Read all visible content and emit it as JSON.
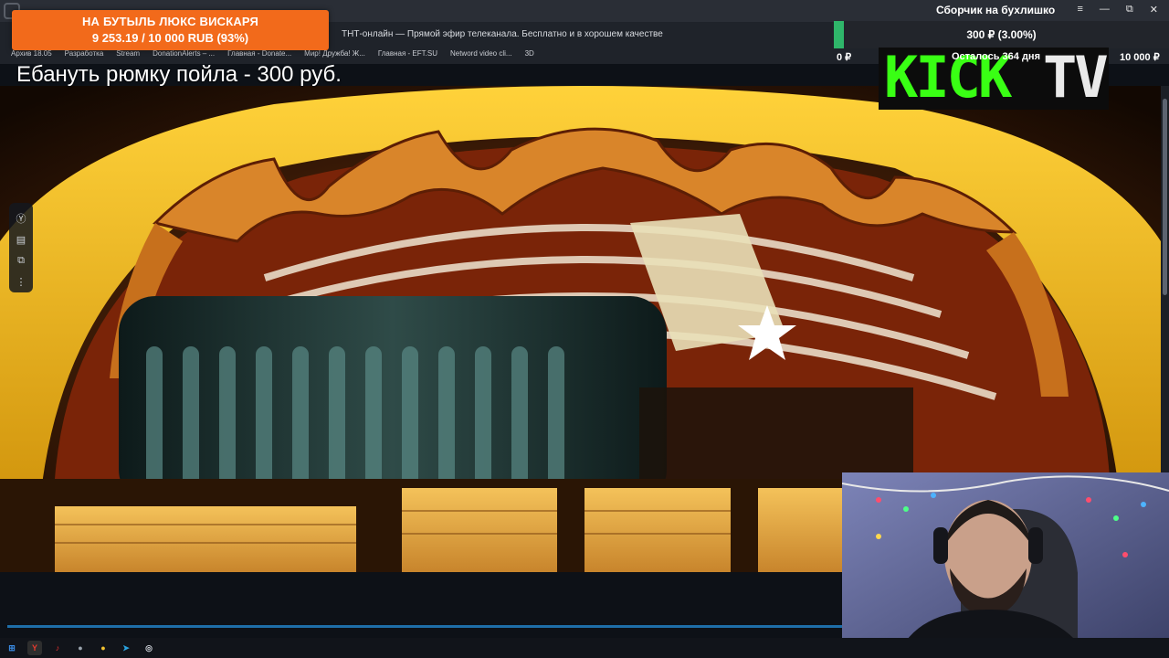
{
  "browser": {
    "tab_title": "ТНТ-онлайн — Прямой эфир телеканала. Бесплатно и в хорошем качестве",
    "bookmarks": [
      "Архив 18.05",
      "Разработка",
      "Stream",
      "DonationAlerts – ...",
      "Главная - Donate...",
      "Мир! Дружба! Ж...",
      "Главная - EFT.SU",
      "Netword video cli...",
      "3D"
    ]
  },
  "donation_goal": {
    "title": "НА БУТЫЛЬ ЛЮКС ВИСКАРЯ",
    "amount_text": "9 253.19 / 10 000 RUB (93%)",
    "progress": 0.93,
    "color": "#f26a1b"
  },
  "stream_fund": {
    "title": "Сборчик на бухлишко",
    "value_text": "300 ₽ (3.00%)",
    "progress": 0.03,
    "min_label": "0 ₽",
    "remaining_label": "Осталось 364 дня",
    "max_label": "10 000 ₽",
    "bar_color": "#2fb66a"
  },
  "window_controls": {
    "menu": "≡",
    "minimize": "—",
    "maximize": "⧉",
    "close": "✕"
  },
  "logo": {
    "kick": "KICK",
    "tv": "TV",
    "kick_color": "#39ff14"
  },
  "alert": {
    "text": "Ебануть рюмку пойла - 300 руб."
  },
  "side_toolbar": [
    {
      "name": "assistant-icon",
      "glyph": "Ⓨ"
    },
    {
      "name": "subtitles-icon",
      "glyph": "▤"
    },
    {
      "name": "pip-icon",
      "glyph": "⧉"
    },
    {
      "name": "more-icon",
      "glyph": "⋮"
    }
  ],
  "taskbar": [
    {
      "name": "windows-start-icon",
      "glyph": "⊞",
      "color": "#3b8de6"
    },
    {
      "name": "yandex-browser-icon",
      "glyph": "Y",
      "color": "#ffffff"
    },
    {
      "name": "yandex-music-icon",
      "glyph": "♪",
      "color": "#e6312e"
    },
    {
      "name": "app-icon-a",
      "glyph": "●",
      "color": "#9aa3ad"
    },
    {
      "name": "app-icon-b",
      "glyph": "●",
      "color": "#f2c230"
    },
    {
      "name": "telegram-icon",
      "glyph": "➤",
      "color": "#2aa3e0"
    },
    {
      "name": "obs-icon",
      "glyph": "◎",
      "color": "#cfd3da"
    }
  ]
}
